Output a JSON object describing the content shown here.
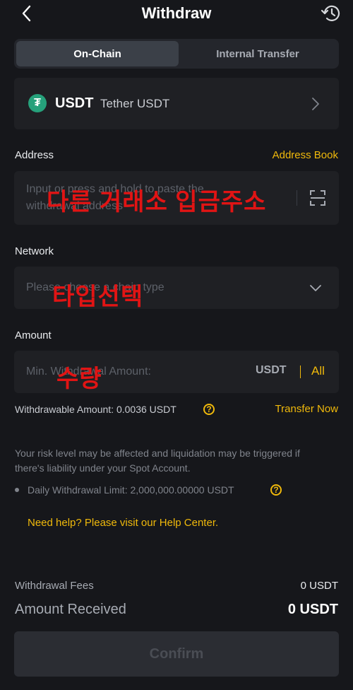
{
  "header": {
    "title": "Withdraw"
  },
  "tabs": [
    {
      "label": "On-Chain",
      "active": true
    },
    {
      "label": "Internal Transfer",
      "active": false
    }
  ],
  "coin": {
    "symbol": "USDT",
    "name": "Tether USDT",
    "icon_text": "₮"
  },
  "address": {
    "label": "Address",
    "book_link": "Address Book",
    "placeholder_line1": "Input or press and hold to paste the",
    "placeholder_line2": "withdrawal address",
    "overlay": "다른 거래소 입금주소"
  },
  "network": {
    "label": "Network",
    "placeholder": "Please choose a chain type",
    "overlay": "타입선택"
  },
  "amount": {
    "label": "Amount",
    "placeholder": "Min. Withdrawal Amount:",
    "unit": "USDT",
    "all": "All",
    "overlay": "수량",
    "withdrawable": "Withdrawable Amount: 0.0036 USDT",
    "transfer_link": "Transfer Now"
  },
  "notes": {
    "risk_line1": "Your risk level may be affected and liquidation may be triggered if",
    "risk_line2": "there's liability under your Spot Account.",
    "daily_limit": "Daily Withdrawal Limit: 2,000,000.00000 USDT",
    "help": "Need help? Please visit our Help Center."
  },
  "fees": {
    "fee_label": "Withdrawal Fees",
    "fee_value": "0 USDT",
    "received_label": "Amount Received",
    "received_value": "0 USDT"
  },
  "confirm": {
    "label": "Confirm"
  },
  "colors": {
    "accent": "#f0b90b",
    "tether": "#26a17b",
    "overlay": "#e11414"
  }
}
